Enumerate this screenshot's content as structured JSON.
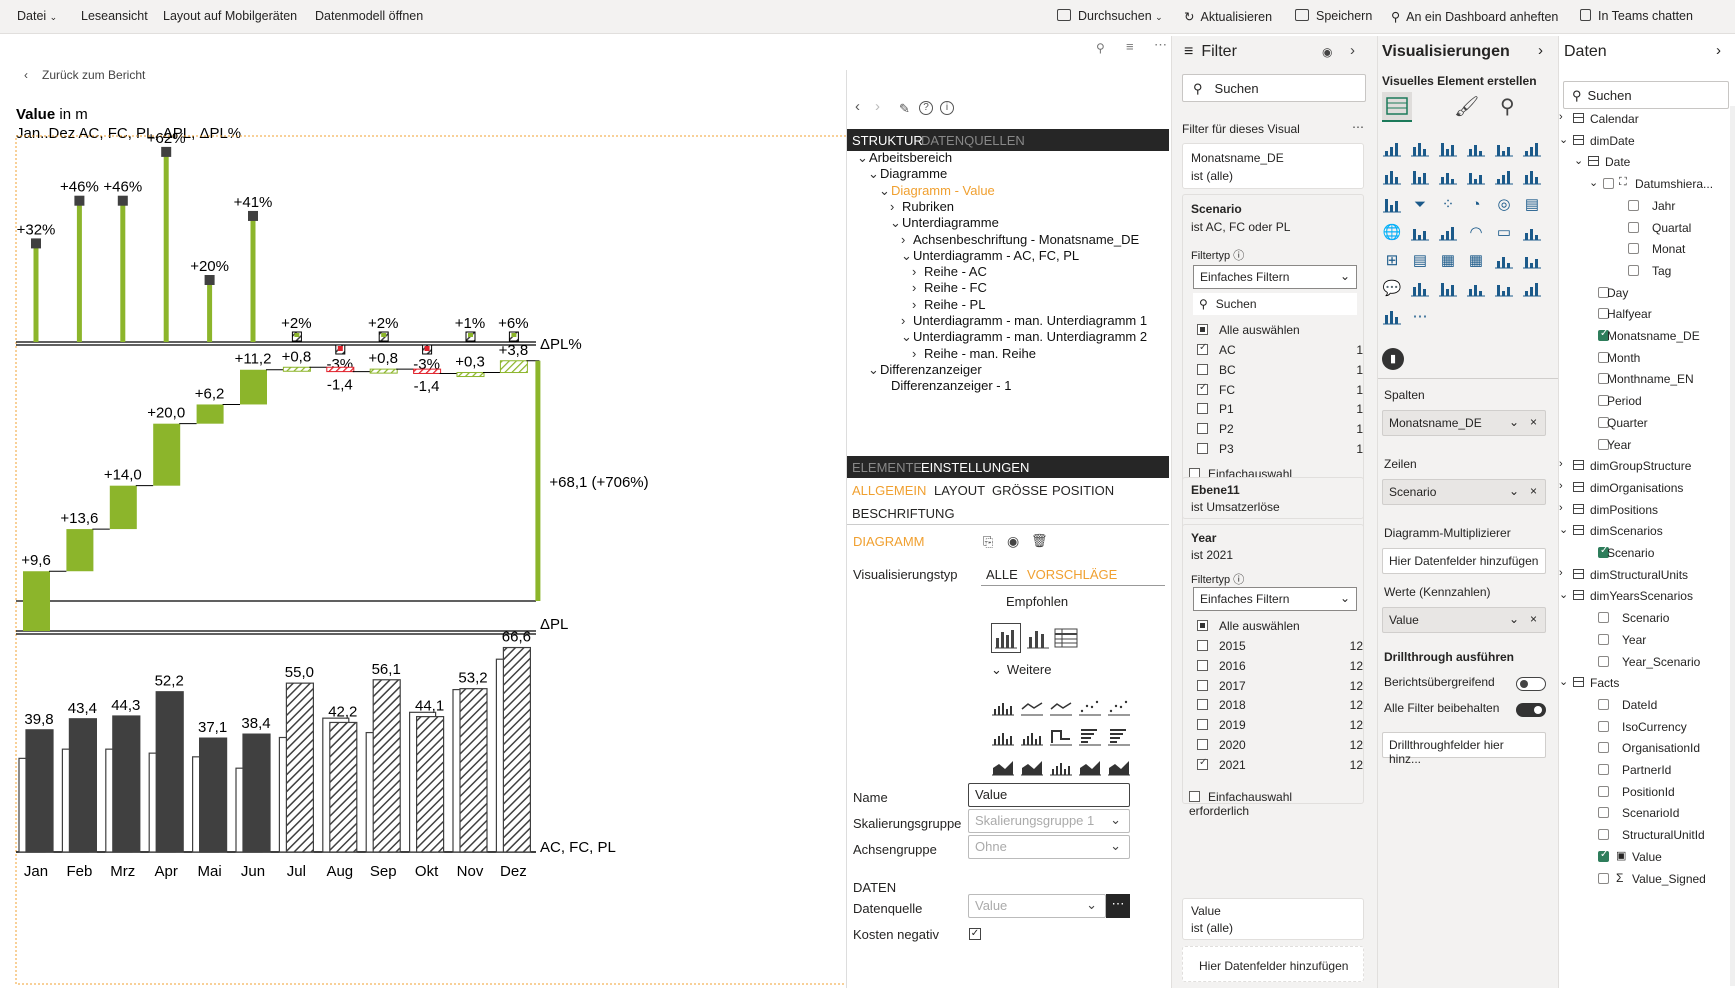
{
  "topbar": {
    "file": "Datei",
    "reading_view": "Leseansicht",
    "mobile_layout": "Layout auf Mobilgeräten",
    "open_model": "Datenmodell öffnen",
    "explore": "Durchsuchen",
    "refresh": "Aktualisieren",
    "save": "Speichern",
    "pin_dashboard": "An ein Dashboard anheften",
    "teams_chat": "In Teams chatten"
  },
  "canvas": {
    "back": "Zurück zum Bericht",
    "title_bold": "Value",
    "title_rest": " in m",
    "subtitle": "Jan..Dez AC, FC, PL, ΔPL, ΔPL%"
  },
  "chart_data": [
    {
      "type": "bar",
      "title": "ΔPL%",
      "categories": [
        "Jan",
        "Feb",
        "Mrz",
        "Apr",
        "Mai",
        "Jun",
        "Jul",
        "Aug",
        "Sep",
        "Okt",
        "Nov",
        "Dez"
      ],
      "values": [
        32,
        46,
        46,
        62,
        20,
        41,
        2,
        -3,
        2,
        -3,
        1,
        6
      ],
      "labels": [
        "+32%",
        "+46%",
        "+46%",
        "+62%",
        "+20%",
        "+41%",
        "+2%",
        "-3%",
        "+2%",
        "-3%",
        "+1%",
        "+6%"
      ]
    },
    {
      "type": "bar",
      "title": "ΔPL",
      "categories": [
        "Jan",
        "Feb",
        "Mrz",
        "Apr",
        "Mai",
        "Jun",
        "Jul",
        "Aug",
        "Sep",
        "Okt",
        "Nov",
        "Dez"
      ],
      "values": [
        9.6,
        13.6,
        14.0,
        20.0,
        6.2,
        11.2,
        0.8,
        -1.4,
        0.8,
        -1.4,
        0.3,
        3.8
      ],
      "labels": [
        "+9,6",
        "+13,6",
        "+14,0",
        "+20,0",
        "+6,2",
        "+11,2",
        "+0,8",
        "-1,4",
        "+0,8",
        "-1,4",
        "+0,3",
        "+3,8"
      ],
      "total_label": "+68,1 (+706%)"
    },
    {
      "type": "bar",
      "title": "AC, FC, PL",
      "categories": [
        "Jan",
        "Feb",
        "Mrz",
        "Apr",
        "Mai",
        "Jun",
        "Jul",
        "Aug",
        "Sep",
        "Okt",
        "Nov",
        "Dez"
      ],
      "values": [
        39.8,
        43.4,
        44.3,
        52.2,
        37.1,
        38.4,
        55.0,
        42.2,
        56.1,
        44.1,
        53.2,
        66.6
      ],
      "labels": [
        "39,8",
        "43,4",
        "44,3",
        "52,2",
        "37,1",
        "38,4",
        "55,0",
        "42,2",
        "56,1",
        "44,1",
        "53,2",
        "66,6"
      ],
      "scenario": [
        "AC",
        "AC",
        "AC",
        "AC",
        "AC",
        "AC",
        "FC",
        "FC",
        "FC",
        "FC",
        "FC",
        "FC"
      ]
    }
  ],
  "zebra": {
    "tab_structure": "STRUKTUR",
    "tab_sources": "DATENQUELLEN",
    "tree": [
      {
        "label": "Arbeitsbereich",
        "indent": 0,
        "caret": "down",
        "hl": false
      },
      {
        "label": "Diagramme",
        "indent": 1,
        "caret": "down",
        "hl": false
      },
      {
        "label": "Diagramm - Value",
        "indent": 2,
        "caret": "down",
        "hl": true
      },
      {
        "label": "Rubriken",
        "indent": 3,
        "caret": "right",
        "hl": false
      },
      {
        "label": "Unterdiagramme",
        "indent": 3,
        "caret": "down",
        "hl": false
      },
      {
        "label": "Achsenbeschriftung - Monatsname_DE",
        "indent": 4,
        "caret": "right",
        "hl": false
      },
      {
        "label": "Unterdiagramm - AC, FC, PL",
        "indent": 4,
        "caret": "down",
        "hl": false
      },
      {
        "label": "Reihe - AC",
        "indent": 5,
        "caret": "right",
        "hl": false
      },
      {
        "label": "Reihe - FC",
        "indent": 5,
        "caret": "right",
        "hl": false
      },
      {
        "label": "Reihe - PL",
        "indent": 5,
        "caret": "right",
        "hl": false
      },
      {
        "label": "Unterdiagramm - man. Unterdiagramm 1",
        "indent": 4,
        "caret": "right",
        "hl": false
      },
      {
        "label": "Unterdiagramm - man. Unterdiagramm 2",
        "indent": 4,
        "caret": "down",
        "hl": false
      },
      {
        "label": "Reihe - man. Reihe",
        "indent": 5,
        "caret": "right",
        "hl": false
      },
      {
        "label": "Differenzanzeiger",
        "indent": 1,
        "caret": "down",
        "hl": false
      },
      {
        "label": "Differenzanzeiger - 1",
        "indent": 2,
        "caret": "none",
        "hl": false
      }
    ],
    "tab_elements": "ELEMENTE",
    "tab_settings": "EINSTELLUNGEN",
    "sub_general": "ALLGEMEIN",
    "sub_layout": "LAYOUT",
    "sub_size": "GRÖSSE",
    "sub_position": "POSITION",
    "sub_label": "BESCHRIFTUNG",
    "section_chart": "DIAGRAMM",
    "viz_type": "Visualisierungstyp",
    "viz_all": "ALLE",
    "viz_suggest": "VORSCHLÄGE",
    "recommended": "Empfohlen",
    "more": "Weitere",
    "name_label": "Name",
    "name_value": "Value",
    "scale_label": "Skalierungsgruppe",
    "scale_value": "Skalierungsgruppe 1",
    "axis_label": "Achsengruppe",
    "axis_value": "Ohne",
    "section_data": "DATEN",
    "source_label": "Datenquelle",
    "source_value": "Value",
    "cost_label": "Kosten negativ"
  },
  "filter": {
    "title": "Filter",
    "search": "Suchen",
    "for_visual": "Filter für dieses Visual",
    "card1_title": "Monatsname_DE",
    "card1_sub": "ist (alle)",
    "card2_title": "Scenario",
    "card2_sub": "ist AC, FC oder PL",
    "filter_type": "Filtertyp",
    "basic": "Einfaches Filtern",
    "search2": "Suchen",
    "select_all": "Alle auswählen",
    "scenarios": [
      {
        "name": "AC",
        "count": "1",
        "checked": true
      },
      {
        "name": "BC",
        "count": "1",
        "checked": false
      },
      {
        "name": "FC",
        "count": "1",
        "checked": true
      },
      {
        "name": "P1",
        "count": "1",
        "checked": false
      },
      {
        "name": "P2",
        "count": "1",
        "checked": false
      },
      {
        "name": "P3",
        "count": "1",
        "checked": false
      }
    ],
    "single_select": "Einfachauswahl erforderlich",
    "card3_title": "Ebene11",
    "card3_sub": "ist Umsatzerlöse",
    "card4_title": "Year",
    "card4_sub": "ist 2021",
    "years": [
      {
        "name": "2015",
        "count": "12",
        "checked": false
      },
      {
        "name": "2016",
        "count": "12",
        "checked": false
      },
      {
        "name": "2017",
        "count": "12",
        "checked": false
      },
      {
        "name": "2018",
        "count": "12",
        "checked": false
      },
      {
        "name": "2019",
        "count": "12",
        "checked": false
      },
      {
        "name": "2020",
        "count": "12",
        "checked": false
      },
      {
        "name": "2021",
        "count": "12",
        "checked": true
      }
    ],
    "card5_title": "Value",
    "card5_sub": "ist (alle)",
    "add_fields": "Hier Datenfelder hinzufügen"
  },
  "viz": {
    "title": "Visualisierungen",
    "build": "Visuelles Element erstellen",
    "columns": "Spalten",
    "columns_value": "Monatsname_DE",
    "rows": "Zeilen",
    "rows_value": "Scenario",
    "multiplier": "Diagramm-Multiplizierer",
    "add_here": "Hier Datenfelder hinzufügen",
    "values": "Werte (Kennzahlen)",
    "values_value": "Value",
    "drillthrough": "Drillthrough ausführen",
    "cross_report": "Berichtsübergreifend",
    "keep_filters": "Alle Filter beibehalten",
    "drill_fields": "Drillthroughfelder hier hinz...",
    "accent": "#1b7a5a"
  },
  "data": {
    "title": "Daten",
    "search": "Suchen",
    "fields": [
      {
        "label": "Calendar",
        "indent": 0,
        "kind": "table",
        "caret": "right",
        "checked": false
      },
      {
        "label": "dimDate",
        "indent": 0,
        "kind": "table",
        "caret": "down",
        "checked": false
      },
      {
        "label": "Date",
        "indent": 1,
        "kind": "table",
        "caret": "down",
        "checked": false
      },
      {
        "label": "Datumshiera...",
        "indent": 2,
        "kind": "hier",
        "caret": "down",
        "checked": false
      },
      {
        "label": "Jahr",
        "indent": 3,
        "kind": "field",
        "caret": "none",
        "checked": false
      },
      {
        "label": "Quartal",
        "indent": 3,
        "kind": "field",
        "caret": "none",
        "checked": false
      },
      {
        "label": "Monat",
        "indent": 3,
        "kind": "field",
        "caret": "none",
        "checked": false
      },
      {
        "label": "Tag",
        "indent": 3,
        "kind": "field",
        "caret": "none",
        "checked": false
      },
      {
        "label": "Day",
        "indent": 1,
        "kind": "field",
        "caret": "none",
        "checked": false
      },
      {
        "label": "Halfyear",
        "indent": 1,
        "kind": "field",
        "caret": "none",
        "checked": false
      },
      {
        "label": "Monatsname_DE",
        "indent": 1,
        "kind": "field",
        "caret": "none",
        "checked": true
      },
      {
        "label": "Month",
        "indent": 1,
        "kind": "field",
        "caret": "none",
        "checked": false
      },
      {
        "label": "Monthname_EN",
        "indent": 1,
        "kind": "field",
        "caret": "none",
        "checked": false
      },
      {
        "label": "Period",
        "indent": 1,
        "kind": "field",
        "caret": "none",
        "checked": false
      },
      {
        "label": "Quarter",
        "indent": 1,
        "kind": "field",
        "caret": "none",
        "checked": false
      },
      {
        "label": "Year",
        "indent": 1,
        "kind": "field",
        "caret": "none",
        "checked": false
      },
      {
        "label": "dimGroupStructure",
        "indent": 0,
        "kind": "table",
        "caret": "right",
        "checked": false
      },
      {
        "label": "dimOrganisations",
        "indent": 0,
        "kind": "table",
        "caret": "right",
        "checked": false
      },
      {
        "label": "dimPositions",
        "indent": 0,
        "kind": "table",
        "caret": "right",
        "checked": false
      },
      {
        "label": "dimScenarios",
        "indent": 0,
        "kind": "table",
        "caret": "down",
        "checked": false
      },
      {
        "label": "Scenario",
        "indent": 1,
        "kind": "field",
        "caret": "none",
        "checked": true
      },
      {
        "label": "dimStructuralUnits",
        "indent": 0,
        "kind": "table",
        "caret": "right",
        "checked": false
      },
      {
        "label": "dimYearsScenarios",
        "indent": 0,
        "kind": "table",
        "caret": "down",
        "checked": false
      },
      {
        "label": "Scenario",
        "indent": 1,
        "kind": "field",
        "caret": "none",
        "checked": false
      },
      {
        "label": "Year",
        "indent": 1,
        "kind": "field",
        "caret": "none",
        "checked": false
      },
      {
        "label": "Year_Scenario",
        "indent": 1,
        "kind": "field",
        "caret": "none",
        "checked": false
      },
      {
        "label": "Facts",
        "indent": 0,
        "kind": "table",
        "caret": "down",
        "checked": false
      },
      {
        "label": "DateId",
        "indent": 1,
        "kind": "field",
        "caret": "none",
        "checked": false
      },
      {
        "label": "IsoCurrency",
        "indent": 1,
        "kind": "field",
        "caret": "none",
        "checked": false
      },
      {
        "label": "OrganisationId",
        "indent": 1,
        "kind": "field",
        "caret": "none",
        "checked": false
      },
      {
        "label": "PartnerId",
        "indent": 1,
        "kind": "field",
        "caret": "none",
        "checked": false
      },
      {
        "label": "PositionId",
        "indent": 1,
        "kind": "field",
        "caret": "none",
        "checked": false
      },
      {
        "label": "ScenarioId",
        "indent": 1,
        "kind": "field",
        "caret": "none",
        "checked": false
      },
      {
        "label": "StructuralUnitId",
        "indent": 1,
        "kind": "field",
        "caret": "none",
        "checked": false
      },
      {
        "label": "Value",
        "indent": 1,
        "kind": "measure",
        "caret": "none",
        "checked": true
      },
      {
        "label": "Value_Signed",
        "indent": 1,
        "kind": "sigma",
        "caret": "none",
        "checked": false
      }
    ]
  },
  "colors": {
    "green": "#8cb52b",
    "dark": "#404040",
    "red": "#e0202a",
    "orange": "#f0a030",
    "zebra_bg": "#262626"
  }
}
